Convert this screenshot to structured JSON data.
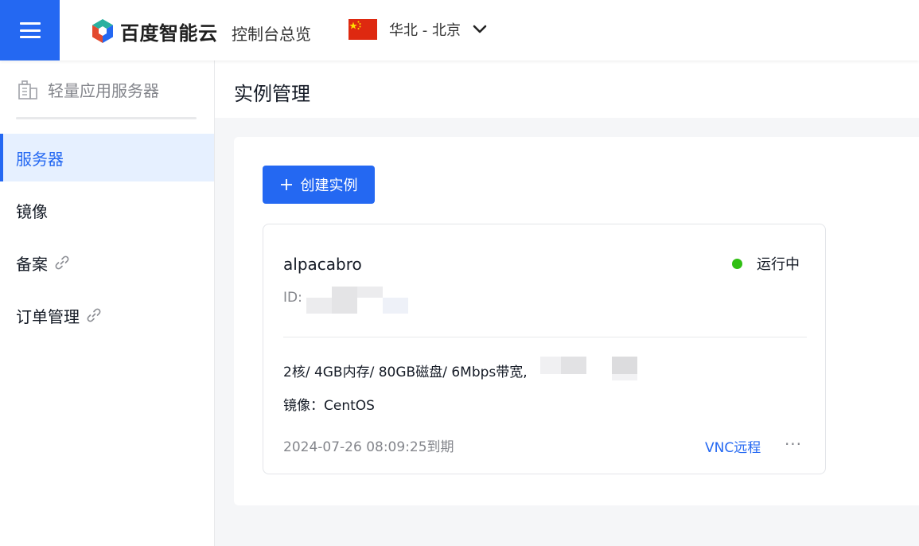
{
  "header": {
    "logo_text": "百度智能云",
    "console_link": "控制台总览",
    "region": "华北 - 北京"
  },
  "sidebar": {
    "title": "轻量应用服务器",
    "items": [
      {
        "label": "服务器",
        "active": true
      },
      {
        "label": "镜像"
      },
      {
        "label": "备案",
        "external": true
      },
      {
        "label": "订单管理",
        "external": true
      }
    ]
  },
  "main": {
    "page_title": "实例管理",
    "create_button": "创建实例",
    "instance": {
      "name": "alpacabro",
      "status": "运行中",
      "id_label": "ID:",
      "specs": "2核/ 4GB内存/ 80GB磁盘/ 6Mbps带宽,",
      "image": "镜像：CentOS",
      "expiry": "2024-07-26 08:09:25到期",
      "vnc_link": "VNC远程",
      "more": "···"
    }
  },
  "colors": {
    "brand": "#2468f2",
    "status_running": "#30bf13",
    "active_bg": "#e6f0ff"
  },
  "icons": [
    "menu-icon",
    "baidu-cloud-logo-icon",
    "china-flag-icon",
    "chevron-down-icon",
    "building-icon",
    "link-icon",
    "plus-icon",
    "more-icon"
  ]
}
